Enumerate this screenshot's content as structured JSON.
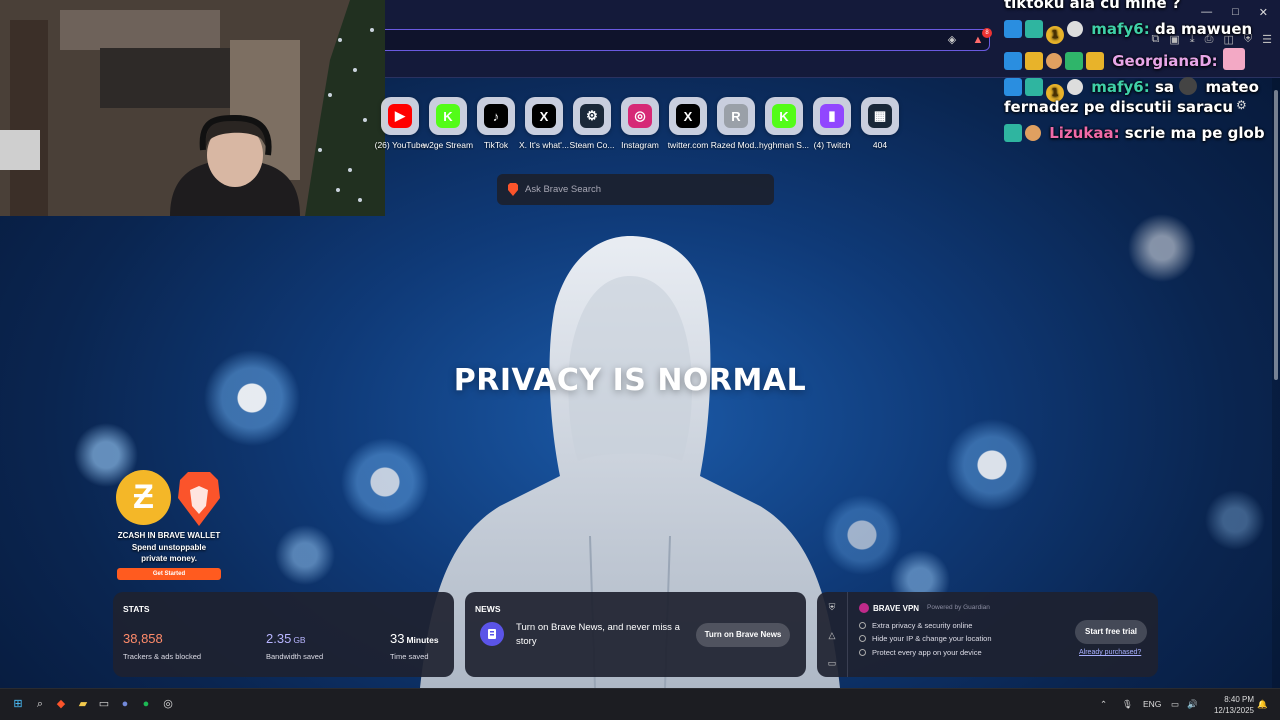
{
  "page": {
    "headline": "PRIVACY IS NORMAL"
  },
  "browser": {
    "notification_count": "8"
  },
  "shortcuts": [
    {
      "label": "(26) YouTube",
      "icon": "youtube-icon",
      "color": "#ff0000",
      "glyph": "▶"
    },
    {
      "label": "w2ge Stream",
      "icon": "kick-icon",
      "color": "#53fc18",
      "glyph": "K"
    },
    {
      "label": "TikTok",
      "icon": "tiktok-icon",
      "color": "#000000",
      "glyph": "♪"
    },
    {
      "label": "X. It's what'...",
      "icon": "x-icon",
      "color": "#000000",
      "glyph": "X"
    },
    {
      "label": "Steam Co...",
      "icon": "steam-icon",
      "color": "#1b2838",
      "glyph": "⚙"
    },
    {
      "label": "Instagram",
      "icon": "instagram-icon",
      "color": "#d62976",
      "glyph": "◎"
    },
    {
      "label": "twitter.com",
      "icon": "x-icon",
      "color": "#000000",
      "glyph": "X"
    },
    {
      "label": "Razed Mod...",
      "icon": "razed-icon",
      "color": "#9aa0a8",
      "glyph": "R"
    },
    {
      "label": "hyghman S...",
      "icon": "kick-icon",
      "color": "#53fc18",
      "glyph": "K"
    },
    {
      "label": "(4) Twitch",
      "icon": "twitch-icon",
      "color": "#9146ff",
      "glyph": "▮"
    },
    {
      "label": "404",
      "icon": "image-tile-icon",
      "color": "#1a2838",
      "glyph": "▦"
    }
  ],
  "search": {
    "placeholder": "Ask Brave Search"
  },
  "chat": {
    "lines": [
      {
        "user": "",
        "text": "tiktoku ala cu mine ?"
      },
      {
        "user": "mafy6:",
        "user_color": "#3fd0a8",
        "text": "da mawuen"
      },
      {
        "user": "GeorgianaD:",
        "user_color": "#e8a6e8",
        "text": ""
      },
      {
        "user": "mafy6:",
        "user_color": "#3fd0a8",
        "text": "sa",
        "text2": "mateo"
      },
      {
        "user": "",
        "text": "fernadez pe discutii saracu"
      },
      {
        "user": "Lizukaa:",
        "user_color": "#f06aa8",
        "text": "scrie ma pe glob"
      }
    ]
  },
  "zcash": {
    "title": "ZCASH IN BRAVE WALLET",
    "line1": "Spend unstoppable",
    "line2": "private money.",
    "cta": "Get Started"
  },
  "stats": {
    "title": "STATS",
    "trackers_value": "38,858",
    "trackers_label": "Trackers & ads blocked",
    "trackers_color": "#ff8b6a",
    "bandwidth_value": "2.35",
    "bandwidth_unit": "GB",
    "bandwidth_label": "Bandwidth saved",
    "bandwidth_color": "#b8b5ff",
    "time_value": "33",
    "time_unit": "Minutes",
    "time_label": "Time saved"
  },
  "news": {
    "title": "NEWS",
    "message": "Turn on Brave News, and never miss a story",
    "button": "Turn on Brave News"
  },
  "vpn": {
    "brand": "BRAVE VPN",
    "powered": "Powered by Guardian",
    "features": [
      "Extra privacy & security online",
      "Hide your IP & change your location",
      "Protect every app on your device"
    ],
    "trial_button": "Start free trial",
    "already": "Already purchased?"
  },
  "taskbar": {
    "language": "ENG",
    "time": "8:40 PM",
    "date": "12/13/2025"
  }
}
